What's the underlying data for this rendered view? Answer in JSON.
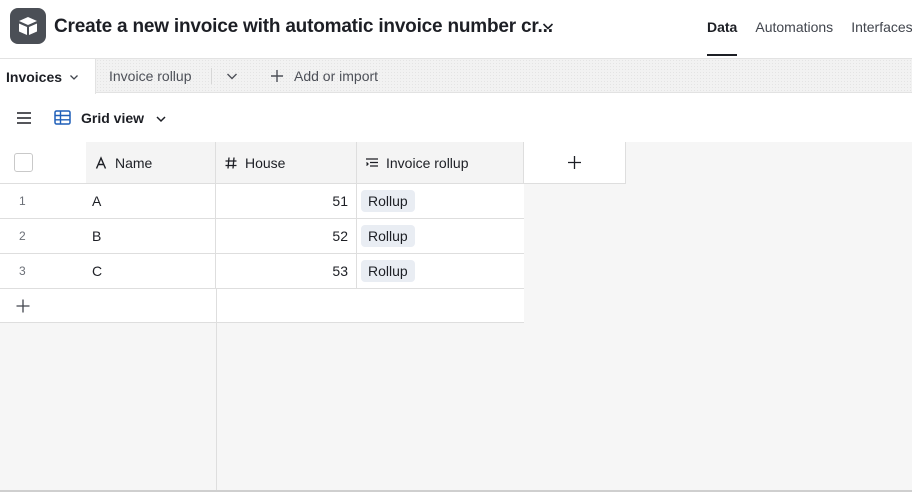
{
  "header": {
    "base_title": "Create a new invoice with automatic invoice number cr...",
    "nav": [
      "Data",
      "Automations",
      "Interfaces"
    ]
  },
  "tabs": {
    "active": "Invoices",
    "other": "Invoice rollup",
    "add_import": "Add or import"
  },
  "view": {
    "name": "Grid view"
  },
  "table": {
    "columns": [
      "Name",
      "House",
      "Invoice rollup"
    ],
    "rows": [
      {
        "num": "1",
        "name": "A",
        "house": "51",
        "rollup": "Rollup"
      },
      {
        "num": "2",
        "name": "B",
        "house": "52",
        "rollup": "Rollup"
      },
      {
        "num": "3",
        "name": "C",
        "house": "53",
        "rollup": "Rollup"
      }
    ]
  },
  "icons": {
    "logo": "airtable-logo-icon",
    "title_menu": "chevron-down-icon",
    "tab_menu": "chevron-down-icon",
    "more_tables": "chevron-down-icon",
    "add": "plus-icon",
    "sidebar_toggle": "hamburger-menu-icon",
    "view_type": "grid-icon",
    "field_name": "text-field-icon",
    "field_number": "hash-icon",
    "field_rollup": "rollup-field-icon"
  },
  "colors": {
    "logo_bg": "#4b4f56",
    "grid_icon": "#1f5fb8",
    "pill_bg": "#e9edf3",
    "canvas_bg": "#f6f6f6"
  }
}
